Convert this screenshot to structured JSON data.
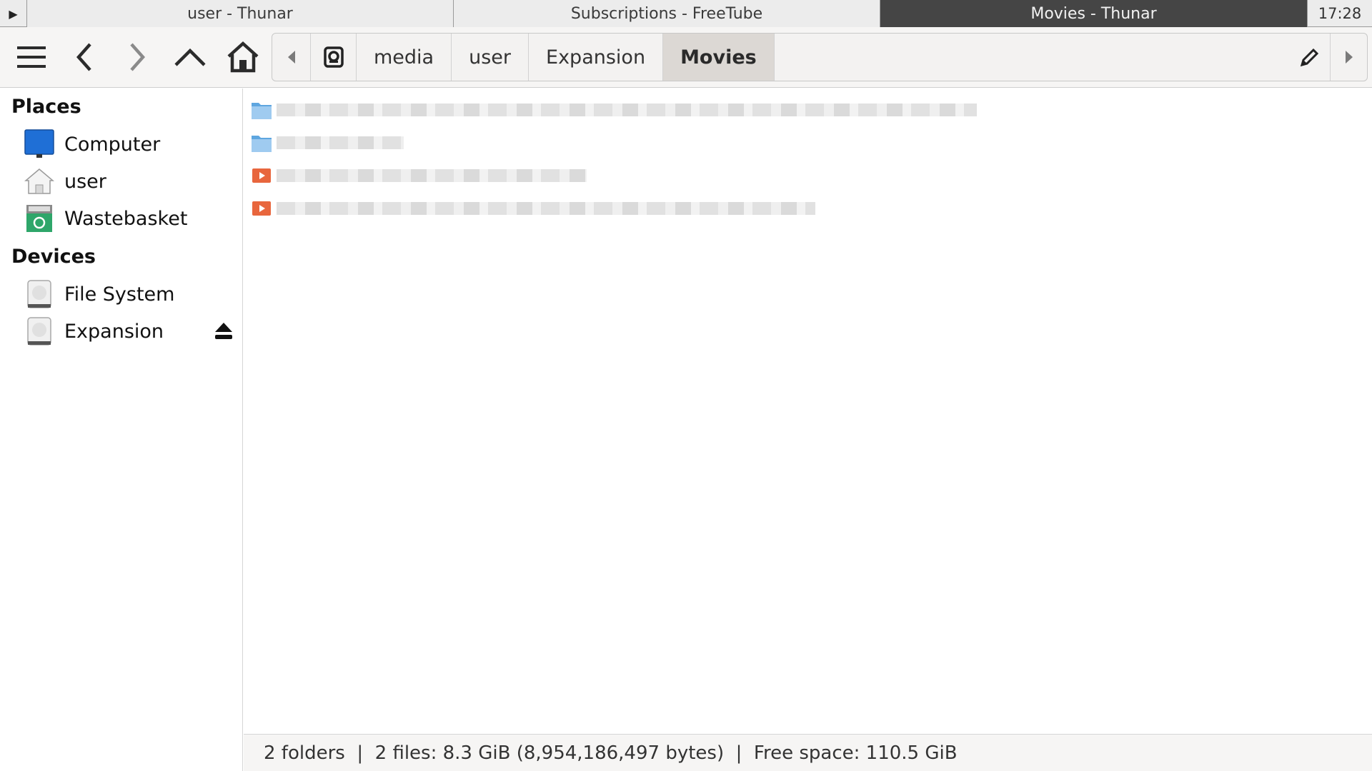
{
  "taskbar": {
    "menu_glyph": "▶",
    "tasks": [
      {
        "title": "user - Thunar",
        "active": false
      },
      {
        "title": "Subscriptions - FreeTube",
        "active": false
      },
      {
        "title": "Movies - Thunar",
        "active": true
      }
    ],
    "clock": "17:28"
  },
  "toolbar": {
    "buttons": [
      "menu-icon",
      "back-icon",
      "forward-icon",
      "up-icon",
      "home-icon"
    ],
    "pathbar": {
      "crumbs": [
        "media",
        "user",
        "Expansion",
        "Movies"
      ],
      "active_crumb": "Movies"
    }
  },
  "sidebar": {
    "places_heading": "Places",
    "places": [
      {
        "label": "Computer",
        "icon": "computer-icon"
      },
      {
        "label": "user",
        "icon": "home-folder-icon"
      },
      {
        "label": "Wastebasket",
        "icon": "wastebasket-icon"
      }
    ],
    "devices_heading": "Devices",
    "devices": [
      {
        "label": "File System",
        "icon": "drive-icon"
      },
      {
        "label": "Expansion",
        "icon": "drive-icon",
        "ejectable": true
      }
    ]
  },
  "files": [
    {
      "type": "folder",
      "icon": "folder-icon"
    },
    {
      "type": "folder",
      "icon": "folder-icon"
    },
    {
      "type": "video",
      "icon": "video-file-icon"
    },
    {
      "type": "video",
      "icon": "video-file-icon"
    }
  ],
  "status": {
    "text": "2 folders  |  2 files: 8.3 GiB (8,954,186,497 bytes)  |  Free space: 110.5 GiB"
  },
  "colors": {
    "active_task_bg": "#454545",
    "folder_blue": "#5ea6e0",
    "computer_blue": "#1f6fd6",
    "video_orange": "#e8663d"
  }
}
